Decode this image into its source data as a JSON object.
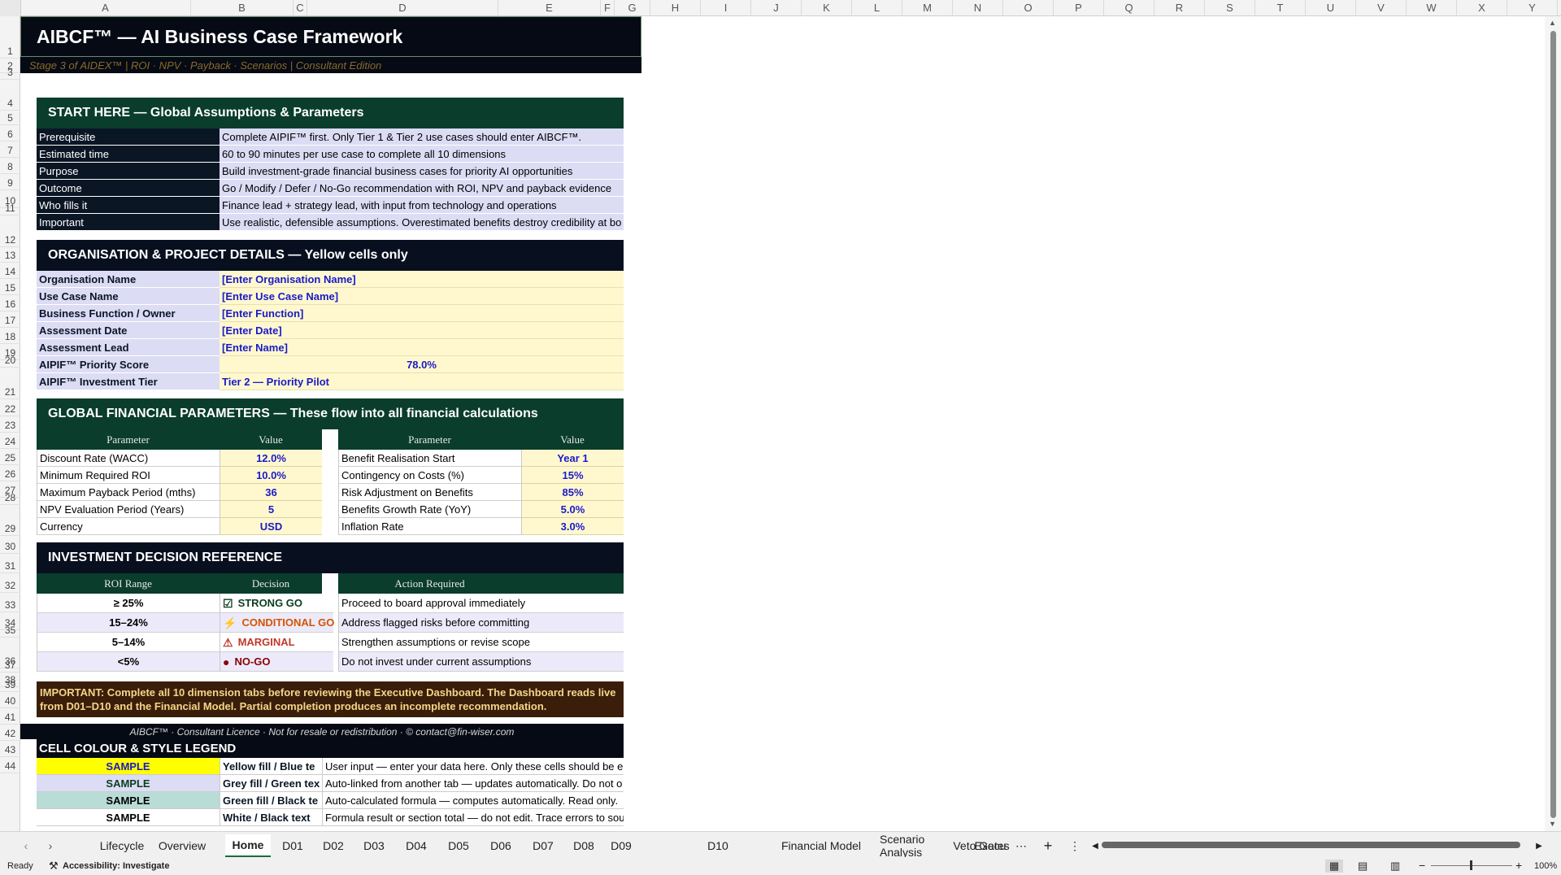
{
  "columns": [
    "A",
    "B",
    "C",
    "D",
    "E",
    "F",
    "G",
    "H",
    "I",
    "J",
    "K",
    "L",
    "M",
    "N",
    "O",
    "P",
    "Q",
    "R",
    "S",
    "T",
    "U",
    "V",
    "W",
    "X",
    "Y"
  ],
  "rows": [
    "1",
    "2",
    "3",
    "4",
    "5",
    "6",
    "7",
    "8",
    "9",
    "10",
    "11",
    "12",
    "13",
    "14",
    "15",
    "16",
    "17",
    "18",
    "19",
    "20",
    "21",
    "22",
    "23",
    "24",
    "25",
    "26",
    "27",
    "28",
    "29",
    "30",
    "31",
    "32",
    "33",
    "34",
    "35",
    "36",
    "37",
    "38",
    "39",
    "40",
    "41",
    "42",
    "43",
    "44"
  ],
  "title": "AIBCF™  —  AI Business Case Framework",
  "subtitle": "Stage 3 of AIDEX™  |  ROI · NPV · Payback · Scenarios  |  Consultant Edition",
  "start_here": {
    "header": "START HERE  —  Global Assumptions & Parameters",
    "rows": [
      {
        "label": "Prerequisite",
        "value": "Complete AIPIF™ first. Only Tier 1 & Tier 2 use cases should enter AIBCF™."
      },
      {
        "label": "Estimated time",
        "value": "60 to 90 minutes per use case to complete all 10 dimensions"
      },
      {
        "label": "Purpose",
        "value": "Build investment-grade financial business cases for priority AI opportunities"
      },
      {
        "label": "Outcome",
        "value": "Go / Modify / Defer / No-Go recommendation with ROI, NPV and payback evidence"
      },
      {
        "label": "Who fills it",
        "value": "Finance lead + strategy lead, with input from technology and operations"
      },
      {
        "label": "Important",
        "value": "Use realistic, defensible assumptions. Overestimated benefits destroy credibility at bo"
      }
    ]
  },
  "org": {
    "header": "ORGANISATION & PROJECT DETAILS  —  Yellow cells only",
    "rows": [
      {
        "label": "Organisation Name",
        "value": "[Enter Organisation Name]"
      },
      {
        "label": "Use Case Name",
        "value": "[Enter Use Case Name]"
      },
      {
        "label": "Business Function / Owner",
        "value": "[Enter Function]"
      },
      {
        "label": "Assessment Date",
        "value": "[Enter Date]"
      },
      {
        "label": "Assessment Lead",
        "value": "[Enter Name]"
      },
      {
        "label": "AIPIF™ Priority Score",
        "value": "78.0%"
      },
      {
        "label": "AIPIF™ Investment Tier",
        "value": "Tier 2 — Priority Pilot"
      }
    ]
  },
  "fin": {
    "header": "GLOBAL FINANCIAL PARAMETERS  —  These flow into all financial calculations",
    "col_param": "Parameter",
    "col_value": "Value",
    "left": [
      {
        "param": "Discount Rate (WACC)",
        "value": "12.0%"
      },
      {
        "param": "Minimum Required ROI",
        "value": "10.0%"
      },
      {
        "param": "Maximum Payback Period (mths)",
        "value": "36"
      },
      {
        "param": "NPV Evaluation Period (Years)",
        "value": "5"
      },
      {
        "param": "Currency",
        "value": "USD"
      }
    ],
    "right": [
      {
        "param": "Benefit Realisation Start",
        "value": "Year 1"
      },
      {
        "param": "Contingency on Costs (%)",
        "value": "15%"
      },
      {
        "param": "Risk Adjustment on Benefits",
        "value": "85%"
      },
      {
        "param": "Benefits Growth Rate (YoY)",
        "value": "5.0%"
      },
      {
        "param": "Inflation Rate",
        "value": "3.0%"
      }
    ]
  },
  "decision": {
    "header": "INVESTMENT DECISION REFERENCE",
    "col_roi": "ROI Range",
    "col_decision": "Decision",
    "col_action": "Action Required",
    "rows": [
      {
        "roi": "≥ 25%",
        "decision": "STRONG GO",
        "icon": "check-box-icon",
        "color": "#0b3d20",
        "action": "Proceed to board approval immediately"
      },
      {
        "roi": "15–24%",
        "decision": "CONDITIONAL GO",
        "icon": "lightning-icon",
        "color": "#d35400",
        "action": "Address flagged risks before committing"
      },
      {
        "roi": "5–14%",
        "decision": "MARGINAL",
        "icon": "warning-icon",
        "color": "#c0392b",
        "action": "Strengthen assumptions or revise scope"
      },
      {
        "roi": "<5%",
        "decision": "NO-GO",
        "icon": "red-circle-icon",
        "color": "#8b0000",
        "action": "Do not invest under current assumptions"
      }
    ]
  },
  "important_note": "IMPORTANT:  Complete all 10 dimension tabs before reviewing the Executive Dashboard. The Dashboard reads live from D01–D10 and the Financial Model. Partial completion produces an incomplete recommendation.",
  "licence_line": "AIBCF™  ·  Consultant Licence  ·  Not for resale or redistribution  ·  © contact@fin-wiser.com",
  "legend": {
    "header": "CELL COLOUR & STYLE LEGEND",
    "rows": [
      {
        "sample": "SAMPLE",
        "style": "Yellow fill / Blue te",
        "desc": "User input — enter your data here. Only these cells should be e",
        "fill": "#ffff00",
        "text": "#1a1ac8"
      },
      {
        "sample": "SAMPLE",
        "style": "Grey fill / Green tex",
        "desc": "Auto-linked from another tab — updates automatically. Do not o",
        "fill": "#dcdcf5",
        "text": "#0b3d20"
      },
      {
        "sample": "SAMPLE",
        "style": "Green fill / Black te",
        "desc": "Auto-calculated formula — computes automatically. Read only.",
        "fill": "#b9dcd6",
        "text": "#000000"
      },
      {
        "sample": "SAMPLE",
        "style": "White / Black text",
        "desc": "Formula result or section total — do not edit. Trace errors to sou",
        "fill": "#ffffff",
        "text": "#000000"
      }
    ]
  },
  "tabs": [
    "Lifecycle",
    "Overview",
    "Home",
    "D01",
    "D02",
    "D03",
    "D04",
    "D05",
    "D06",
    "D07",
    "D08",
    "D09",
    "D10",
    "Financial Model",
    "Scenario Analysis",
    "Veto Gates",
    "Execu"
  ],
  "active_tab": "Home",
  "status": {
    "ready": "Ready",
    "accessibility": "Accessibility: Investigate",
    "zoom": "100%"
  },
  "icons": {
    "prev_sheet": "chevron-left-icon",
    "next_sheet": "chevron-right-icon",
    "more_tabs": "ellipsis-icon",
    "add_sheet": "plus-icon",
    "options": "vertical-ellipsis-icon"
  }
}
